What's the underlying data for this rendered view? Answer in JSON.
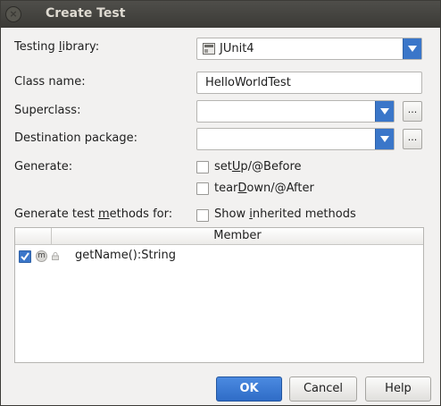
{
  "window": {
    "title": "Create Test",
    "close_glyph": "×"
  },
  "form": {
    "testing_library": {
      "label_pre": "Testing ",
      "label_mn": "l",
      "label_post": "ibrary:",
      "value": "JUnit4"
    },
    "class_name": {
      "label": "Class name:",
      "value": "HelloWorldTest"
    },
    "superclass": {
      "label": "Superclass:",
      "value": "",
      "browse": "..."
    },
    "destination_package": {
      "label": "Destination package:",
      "value": "",
      "browse": "..."
    },
    "generate": {
      "label": "Generate:",
      "options": [
        {
          "pre": "set",
          "mn": "U",
          "post": "p/@Before",
          "checked": false
        },
        {
          "pre": "tear",
          "mn": "D",
          "post": "own/@After",
          "checked": false
        }
      ]
    },
    "methods_for": {
      "label_pre": "Generate test ",
      "label_mn": "m",
      "label_post": "ethods for:"
    },
    "show_inherited": {
      "pre": "Show ",
      "mn": "i",
      "post": "nherited methods",
      "checked": false
    }
  },
  "table": {
    "header": "Member",
    "rows": [
      {
        "method": "getName():String",
        "checked": true,
        "badge": "m",
        "icon": "lock-icon"
      }
    ]
  },
  "buttons": {
    "ok": "OK",
    "cancel": "Cancel",
    "help": "Help"
  },
  "colors": {
    "accent": "#3a76c9",
    "titlebar": "#3b3a36"
  }
}
